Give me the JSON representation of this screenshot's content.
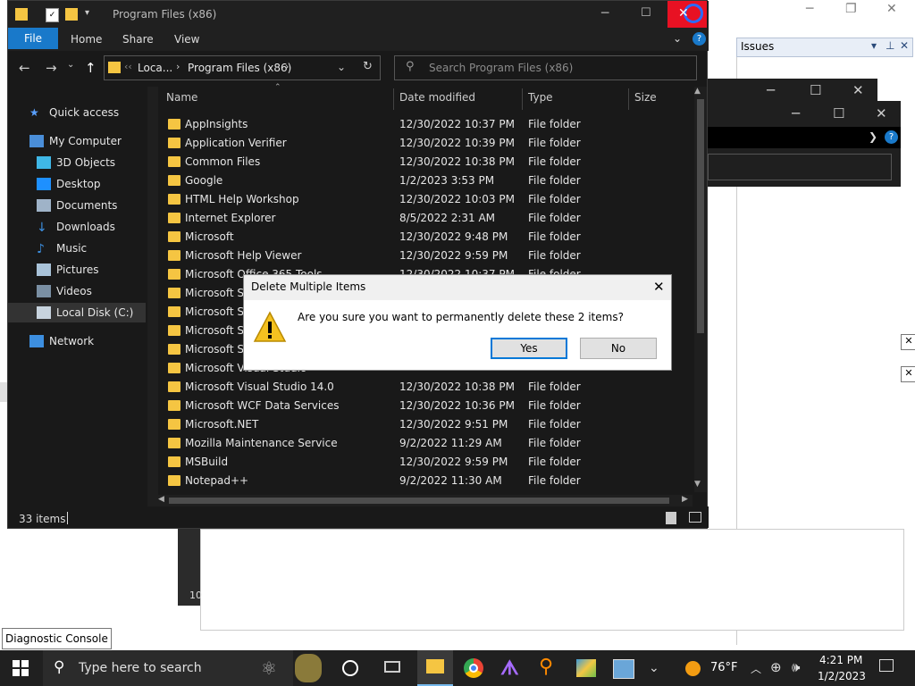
{
  "explorer": {
    "title": "Program Files (x86)",
    "ribbon_tabs": [
      "File",
      "Home",
      "Share",
      "View"
    ],
    "address": {
      "parent": "Loca...",
      "current": "Program Files (x86)"
    },
    "search_placeholder": "Search Program Files (x86)",
    "columns": {
      "name": "Name",
      "date": "Date modified",
      "type": "Type",
      "size": "Size"
    },
    "sidebar": [
      {
        "label": "Quick access",
        "icon": "star-icon"
      },
      {
        "label": "My Computer",
        "icon": "computer-icon"
      },
      {
        "label": "3D Objects",
        "icon": "cube-icon"
      },
      {
        "label": "Desktop",
        "icon": "desktop-icon"
      },
      {
        "label": "Documents",
        "icon": "documents-icon"
      },
      {
        "label": "Downloads",
        "icon": "download-icon"
      },
      {
        "label": "Music",
        "icon": "music-icon"
      },
      {
        "label": "Pictures",
        "icon": "pictures-icon"
      },
      {
        "label": "Videos",
        "icon": "videos-icon"
      },
      {
        "label": "Local Disk (C:)",
        "icon": "drive-icon"
      },
      {
        "label": "Network",
        "icon": "network-icon"
      }
    ],
    "files": [
      {
        "name": "AppInsights",
        "date": "12/30/2022 10:37 PM",
        "type": "File folder"
      },
      {
        "name": "Application Verifier",
        "date": "12/30/2022 10:39 PM",
        "type": "File folder"
      },
      {
        "name": "Common Files",
        "date": "12/30/2022 10:38 PM",
        "type": "File folder"
      },
      {
        "name": "Google",
        "date": "1/2/2023 3:53 PM",
        "type": "File folder"
      },
      {
        "name": "HTML Help Workshop",
        "date": "12/30/2022 10:03 PM",
        "type": "File folder"
      },
      {
        "name": "Internet Explorer",
        "date": "8/5/2022 2:31 AM",
        "type": "File folder"
      },
      {
        "name": "Microsoft",
        "date": "12/30/2022 9:48 PM",
        "type": "File folder"
      },
      {
        "name": "Microsoft Help Viewer",
        "date": "12/30/2022 9:59 PM",
        "type": "File folder"
      },
      {
        "name": "Microsoft Office 365 Tools",
        "date": "12/30/2022 10:37 PM",
        "type": "File folder"
      },
      {
        "name": "Microsoft SDKs",
        "date": "",
        "type": ""
      },
      {
        "name": "Microsoft Silverlight",
        "date": "",
        "type": ""
      },
      {
        "name": "Microsoft SQL Server",
        "date": "",
        "type": ""
      },
      {
        "name": "Microsoft SQL Server Compact",
        "date": "",
        "type": ""
      },
      {
        "name": "Microsoft Visual Studio",
        "date": "",
        "type": ""
      },
      {
        "name": "Microsoft Visual Studio 14.0",
        "date": "12/30/2022 10:38 PM",
        "type": "File folder"
      },
      {
        "name": "Microsoft WCF Data Services",
        "date": "12/30/2022 10:36 PM",
        "type": "File folder"
      },
      {
        "name": "Microsoft.NET",
        "date": "12/30/2022 9:51 PM",
        "type": "File folder"
      },
      {
        "name": "Mozilla Maintenance Service",
        "date": "9/2/2022 11:29 AM",
        "type": "File folder"
      },
      {
        "name": "MSBuild",
        "date": "12/30/2022 9:59 PM",
        "type": "File folder"
      },
      {
        "name": "Notepad++",
        "date": "9/2/2022 11:30 AM",
        "type": "File folder"
      }
    ],
    "status_count": "33 items"
  },
  "dialog": {
    "title": "Delete Multiple Items",
    "message": "Are you sure you want to permanently delete these 2 items?",
    "yes": "Yes",
    "no": "No"
  },
  "issues_panel": {
    "title": "Issues"
  },
  "diagnostic_console": "Diagnostic Console",
  "partial_text": "10",
  "taskbar": {
    "search_placeholder": "Type here to search",
    "weather": "76°F",
    "time": "4:21 PM",
    "date": "1/2/2023"
  },
  "colors": {
    "accent": "#1979ca",
    "close_hover": "#e81123",
    "folder": "#f5c542"
  }
}
